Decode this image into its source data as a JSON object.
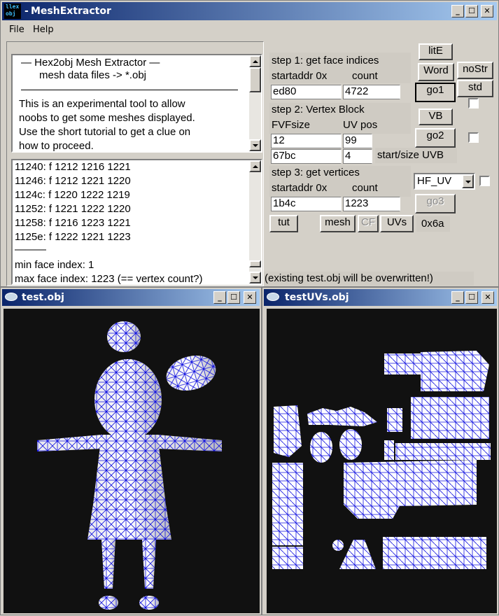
{
  "main_window": {
    "app_icon_text": "llex obj",
    "title": "MeshExtractor",
    "menu": [
      "File",
      "Help"
    ],
    "info_box": {
      "lines": [
        "—   Hex2obj Mesh Extractor   —",
        "mesh data files -> *.obj"
      ],
      "paragraph": [
        "This is an experimental tool to allow",
        "noobs to get some meshes displayed.",
        "Use the short tutorial to get a clue on",
        "how to proceed."
      ]
    },
    "log": {
      "lines": [
        "11240: f  1212 1216 1221",
        "11246: f  1212 1221 1220",
        "1124c: f  1220 1222 1219",
        "11252: f  1221 1222 1220",
        "11258: f  1216 1223 1221",
        "1125e: f  1222 1221 1223"
      ],
      "separator": "———",
      "min_face": "min face index: 1",
      "max_face": "max face index: 1223 (== vertex count?)"
    },
    "step1": {
      "title": "step 1: get face indices",
      "startaddr_label": "startaddr 0x",
      "count_label": "count",
      "startaddr": "ed80",
      "count": "4722"
    },
    "step2": {
      "title": "step 2: Vertex Block",
      "fvf_label": "FVFsize",
      "uv_label": "UV pos",
      "fvf": "12",
      "uv": "99",
      "start_uvb": "67bc",
      "size_uvb": "4",
      "uvb_label": "start/size UVB"
    },
    "step3": {
      "title": "step 3: get vertices",
      "startaddr_label": "startaddr 0x",
      "count_label": "count",
      "startaddr": "1b4c",
      "count": "1223"
    },
    "buttons": {
      "litE": "litE",
      "word": "Word",
      "nostr": "noStr",
      "go1": "go1",
      "std": "std",
      "vb": "VB",
      "go2": "go2",
      "go3": "go3",
      "tut": "tut",
      "mesh": "mesh",
      "cf": "CF",
      "uvs": "UVs"
    },
    "combo_value": "HF_UV",
    "hex_value": "0x6a",
    "warning": "(existing test.obj will be overwritten!)"
  },
  "left_window": {
    "title": "test.obj"
  },
  "right_window": {
    "title": "testUVs.obj"
  },
  "colors": {
    "wire": "#1010e0",
    "viewport_bg": "#111111",
    "title_start": "#0a246a",
    "title_end": "#a6caf0"
  }
}
